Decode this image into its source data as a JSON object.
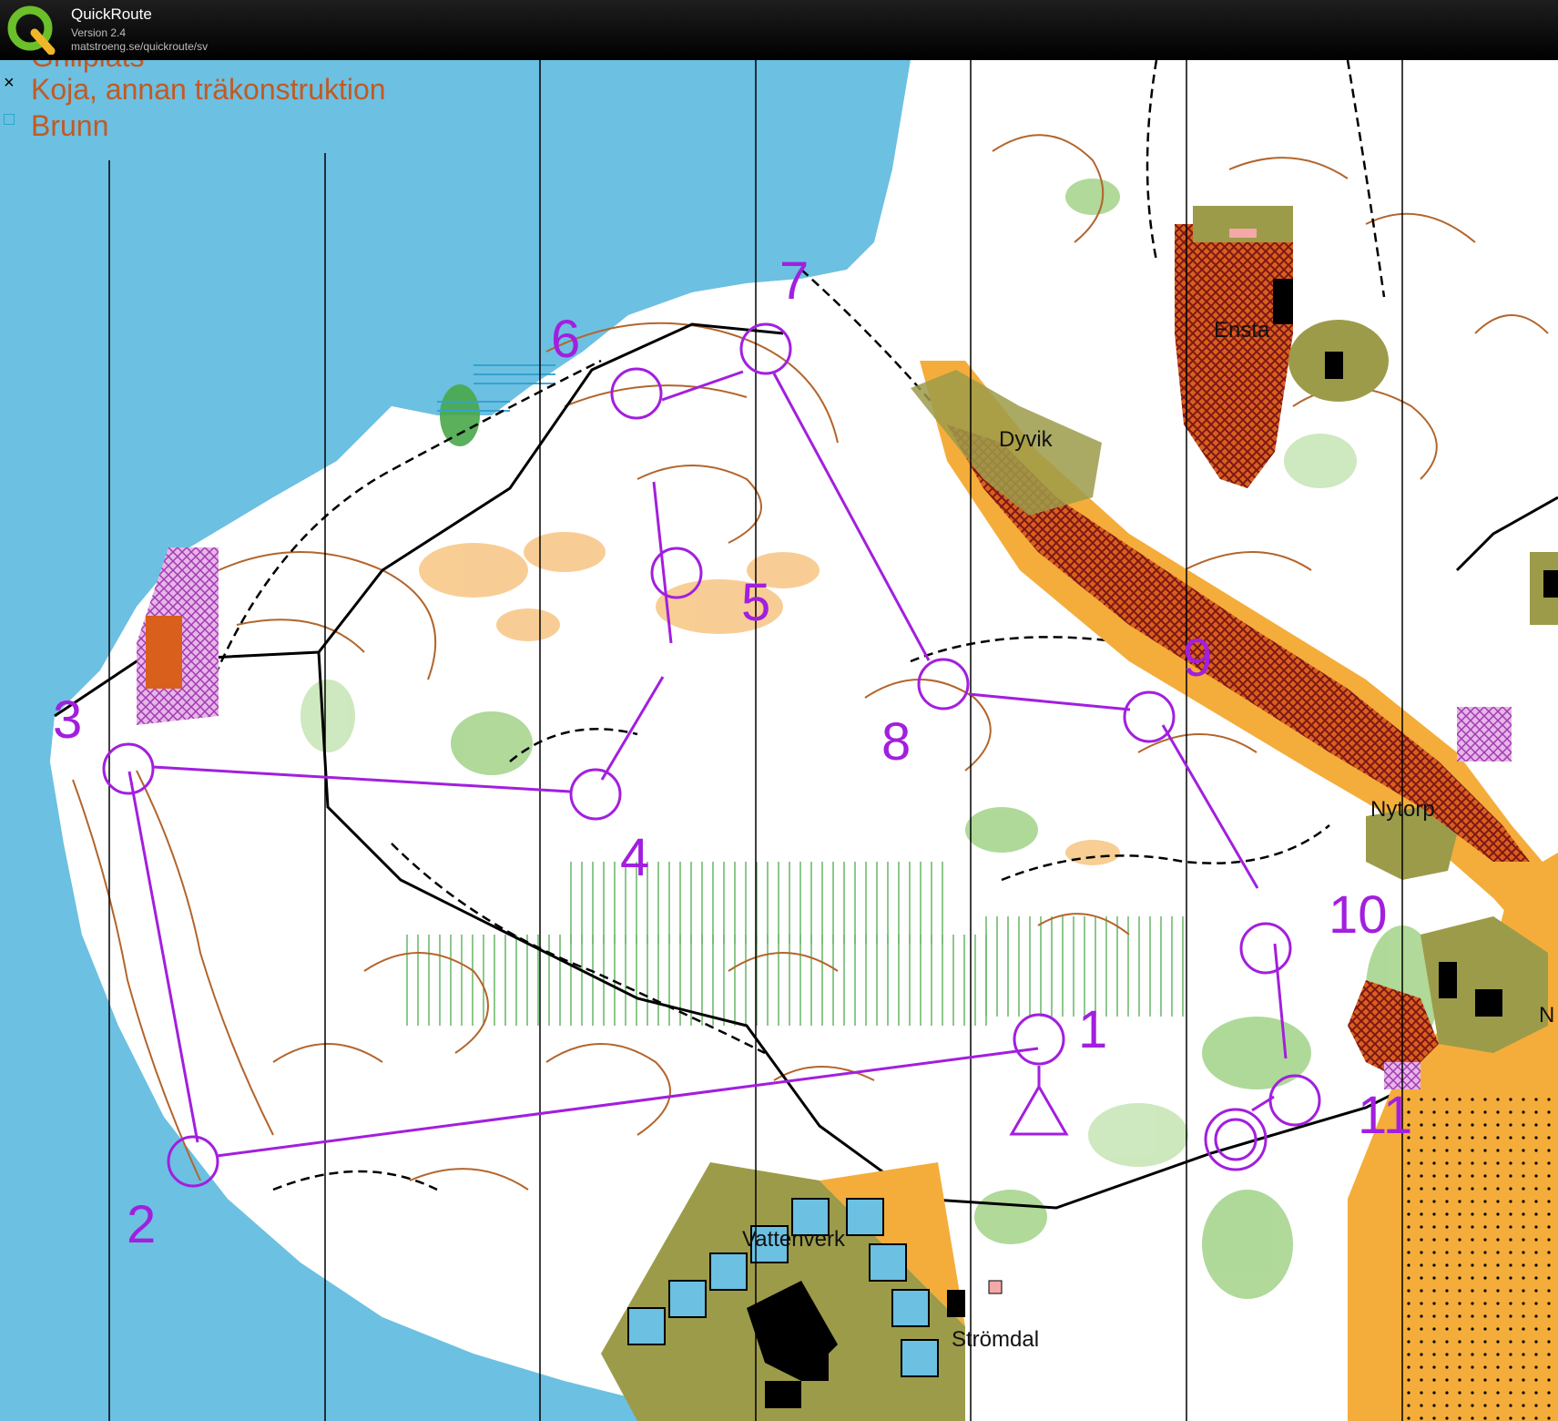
{
  "app": {
    "name": "QuickRoute",
    "version": "Version 2.4",
    "url": "matstroeng.se/quickroute/sv"
  },
  "legend": [
    {
      "symbol": "·",
      "label": "Grillplats",
      "color": "#000000"
    },
    {
      "symbol": "×",
      "label": "Koja, annan träkonstruktion",
      "color": "#000000"
    },
    {
      "symbol": "□",
      "label": "Brunn",
      "color": "#1a9fc9"
    }
  ],
  "course": {
    "color": "#a21fde",
    "controls": [
      "1",
      "2",
      "3",
      "4",
      "5",
      "6",
      "7",
      "8",
      "9",
      "10",
      "11"
    ]
  },
  "place_names": [
    "Ensta",
    "Dyvik",
    "Nytorp",
    "Vattenverk",
    "Strömdal",
    "N"
  ],
  "colors": {
    "water": "#6cc0e2",
    "open_land": "#f7c583",
    "rough_open": "#f4ad3a",
    "green": "#a7d58f",
    "contour": "#b3652c",
    "private": "#8b1c1c",
    "road": "#000000",
    "course": "#a21fde"
  }
}
